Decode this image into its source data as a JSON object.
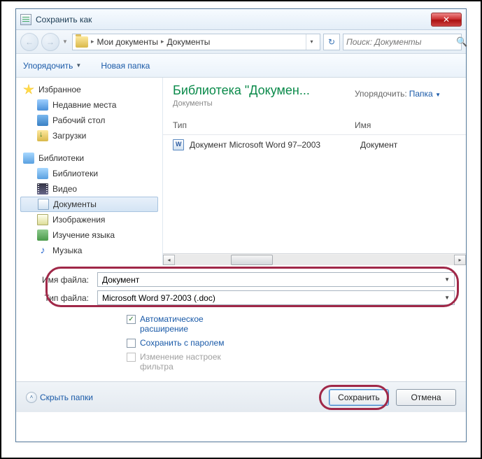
{
  "window": {
    "title": "Сохранить как"
  },
  "nav": {
    "crumb1": "Мои документы",
    "crumb2": "Документы",
    "search_placeholder": "Поиск: Документы"
  },
  "toolbar": {
    "organize": "Упорядочить",
    "new_folder": "Новая папка"
  },
  "sidebar": {
    "favorites": "Избранное",
    "recent": "Недавние места",
    "desktop": "Рабочий стол",
    "downloads": "Загрузки",
    "libraries": "Библиотеки",
    "lib_items": {
      "0": "Библиотеки",
      "1": "Видео",
      "2": "Документы",
      "3": "Изображения",
      "4": "Изучение языка",
      "5": "Музыка"
    }
  },
  "content": {
    "lib_title": "Библиотека \"Докумен...",
    "lib_sub": "Документы",
    "sort_label": "Упорядочить:",
    "sort_value": "Папка",
    "col_type": "Тип",
    "col_name": "Имя",
    "row0_type": "Документ Microsoft Word 97–2003",
    "row0_name": "Документ"
  },
  "form": {
    "filename_label": "Имя файла:",
    "filename_value": "Документ",
    "filetype_label": "Тип файла:",
    "filetype_value": "Microsoft Word 97-2003 (.doc)",
    "auto_ext": "Автоматическое расширение",
    "save_pw": "Сохранить с паролем",
    "filter_settings": "Изменение настроек фильтра"
  },
  "footer": {
    "hide_folders": "Скрыть папки",
    "save": "Сохранить",
    "cancel": "Отмена"
  }
}
